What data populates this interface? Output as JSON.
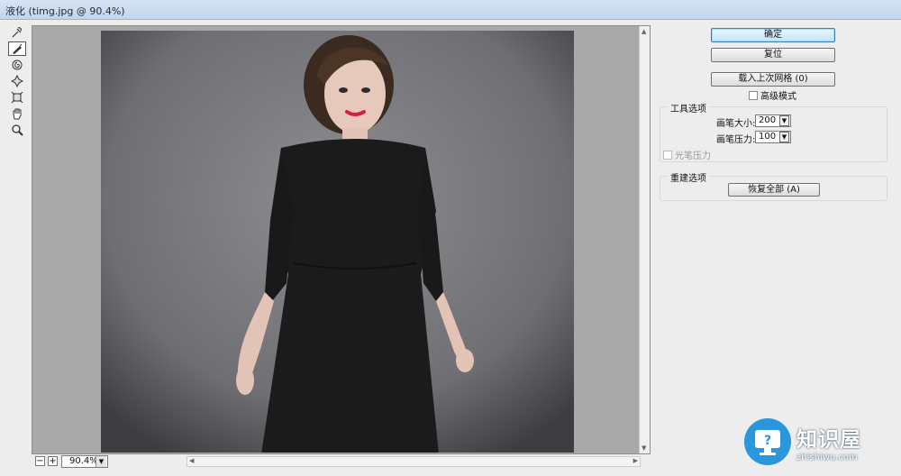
{
  "window": {
    "title": "液化 (timg.jpg @ 90.4%)"
  },
  "tools": [
    "forward-warp",
    "reconstruct",
    "twirl",
    "pucker",
    "bloat",
    "hand",
    "zoom"
  ],
  "canvas": {
    "zoom": "90.4%"
  },
  "panel": {
    "ok_label": "确定",
    "reset_label": "复位",
    "load_mesh_label": "载入上次网格 (0)",
    "advanced_mode_label": "高级模式",
    "tool_options": {
      "title": "工具选项",
      "brush_size_label": "画笔大小:",
      "brush_size_value": "200",
      "brush_pressure_label": "画笔压力:",
      "brush_pressure_value": "100",
      "stylus_pressure_label": "光笔压力"
    },
    "reconstruct": {
      "title": "重建选项",
      "restore_all_label": "恢复全部 (A)"
    }
  },
  "watermark": {
    "name": "知识屋",
    "url": "zhishiwu.com"
  },
  "colors": {
    "accent": "#2a97dc",
    "canvas_bg": "#a9a9a9"
  }
}
